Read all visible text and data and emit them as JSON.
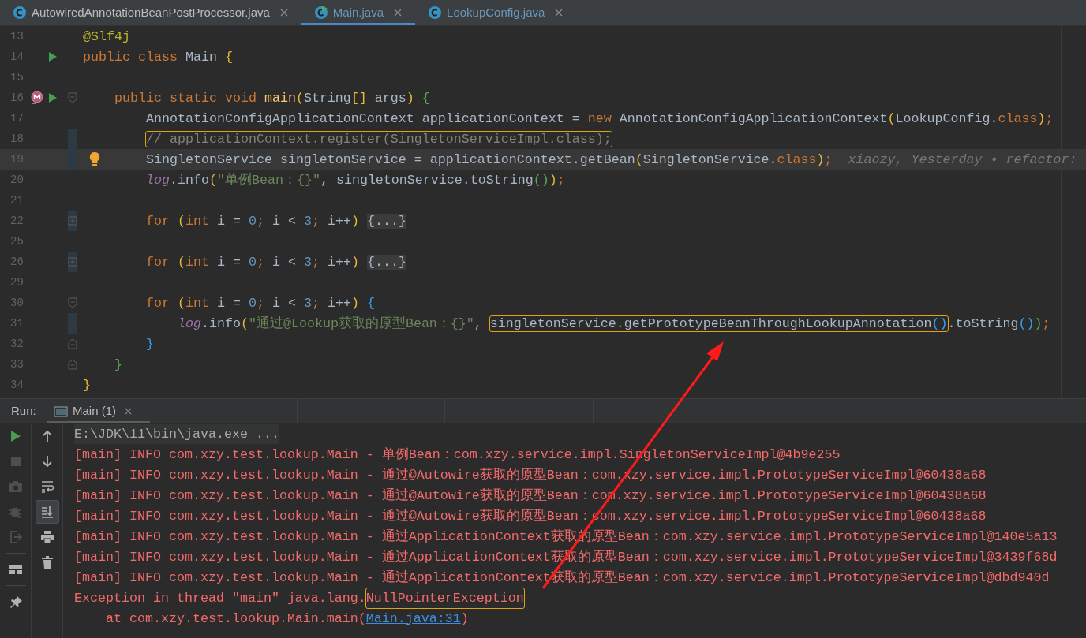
{
  "editor_tabs": [
    {
      "label": "AutowiredAnnotationBeanPostProcessor.java",
      "kind": "class",
      "modified": false,
      "selected": false
    },
    {
      "label": "Main.java",
      "kind": "runnable",
      "modified": true,
      "selected": true
    },
    {
      "label": "LookupConfig.java",
      "kind": "class",
      "modified": true,
      "selected": false
    }
  ],
  "code_lines": [
    {
      "number": "13",
      "changed": false,
      "current": false,
      "segments": [
        {
          "text": "@Slf4j",
          "kind": "annotation"
        }
      ]
    },
    {
      "number": "14",
      "changed": false,
      "current": false,
      "gutter": [
        {
          "kind": "run"
        }
      ],
      "segments": [
        {
          "text": "public class ",
          "kind": "keyword"
        },
        {
          "text": "Main ",
          "kind": "plain"
        },
        {
          "text": "{",
          "kind": "paren1"
        }
      ]
    },
    {
      "number": "15",
      "changed": false,
      "current": false
    },
    {
      "number": "16",
      "changed": false,
      "current": false,
      "gutter": [
        {
          "kind": "method"
        },
        {
          "kind": "run"
        }
      ],
      "fold": {
        "kind": "start"
      },
      "segments": [
        {
          "text": "    public static void ",
          "kind": "keyword"
        },
        {
          "text": "main",
          "kind": "method"
        },
        {
          "text": "(",
          "kind": "paren1"
        },
        {
          "text": "String",
          "kind": "plain"
        },
        {
          "text": "[]",
          "kind": "paren1"
        },
        {
          "text": " args",
          "kind": "plain"
        },
        {
          "text": ")",
          "kind": "paren1"
        },
        {
          "text": " {",
          "kind": "paren2"
        }
      ]
    },
    {
      "number": "17",
      "changed": false,
      "current": false,
      "segments": [
        {
          "text": "        AnnotationConfigApplicationContext applicationContext = ",
          "kind": "plain"
        },
        {
          "text": "new ",
          "kind": "keyword"
        },
        {
          "text": "AnnotationConfigApplicationContext",
          "kind": "plain"
        },
        {
          "text": "(",
          "kind": "paren1"
        },
        {
          "text": "LookupConfig.",
          "kind": "plain"
        },
        {
          "text": "class",
          "kind": "keyword"
        },
        {
          "text": ")",
          "kind": "paren1"
        },
        {
          "text": ";",
          "kind": "keyword"
        }
      ]
    },
    {
      "number": "18",
      "changed": true,
      "current": false,
      "segments": [
        {
          "text": "        // applicationContext.register(SingletonServiceImpl.class);",
          "kind": "comment",
          "boxed": true
        }
      ]
    },
    {
      "number": "19",
      "changed": true,
      "current": true,
      "gutter": [
        {
          "kind": "bulb"
        }
      ],
      "segments": [
        {
          "text": "        SingletonService singletonService = applicationContext.getBean",
          "kind": "plain"
        },
        {
          "text": "(",
          "kind": "paren1"
        },
        {
          "text": "SingletonService.",
          "kind": "plain"
        },
        {
          "text": "class",
          "kind": "keyword"
        },
        {
          "text": ")",
          "kind": "paren1"
        },
        {
          "text": ";",
          "kind": "keyword"
        },
        {
          "text": "  xiaozy, Yesterday • refactor:",
          "kind": "hint"
        }
      ]
    },
    {
      "number": "20",
      "changed": false,
      "current": false,
      "segments": [
        {
          "text": "        log",
          "kind": "field"
        },
        {
          "text": ".info",
          "kind": "plain"
        },
        {
          "text": "(",
          "kind": "paren1"
        },
        {
          "text": "\"单例Bean：{}\"",
          "kind": "string"
        },
        {
          "text": ", singletonService.toString",
          "kind": "plain"
        },
        {
          "text": "()",
          "kind": "paren2"
        },
        {
          "text": ")",
          "kind": "paren1"
        },
        {
          "text": ";",
          "kind": "keyword"
        }
      ]
    },
    {
      "number": "21",
      "changed": false,
      "current": false
    },
    {
      "number": "22",
      "changed": true,
      "current": false,
      "fold": {
        "kind": "collapsed"
      },
      "segments": [
        {
          "text": "        for ",
          "kind": "keyword"
        },
        {
          "text": "(",
          "kind": "paren1"
        },
        {
          "text": "int ",
          "kind": "keyword"
        },
        {
          "text": "i = ",
          "kind": "plain"
        },
        {
          "text": "0",
          "kind": "number"
        },
        {
          "text": "; ",
          "kind": "keyword"
        },
        {
          "text": "i < ",
          "kind": "plain"
        },
        {
          "text": "3",
          "kind": "number"
        },
        {
          "text": "; ",
          "kind": "keyword"
        },
        {
          "text": "i++",
          "kind": "plain"
        },
        {
          "text": ") ",
          "kind": "paren1"
        },
        {
          "text": "{...}",
          "kind": "folded"
        }
      ]
    },
    {
      "number": "25",
      "changed": false,
      "current": false
    },
    {
      "number": "26",
      "changed": true,
      "current": false,
      "fold": {
        "kind": "collapsed"
      },
      "segments": [
        {
          "text": "        for ",
          "kind": "keyword"
        },
        {
          "text": "(",
          "kind": "paren1"
        },
        {
          "text": "int ",
          "kind": "keyword"
        },
        {
          "text": "i = ",
          "kind": "plain"
        },
        {
          "text": "0",
          "kind": "number"
        },
        {
          "text": "; ",
          "kind": "keyword"
        },
        {
          "text": "i < ",
          "kind": "plain"
        },
        {
          "text": "3",
          "kind": "number"
        },
        {
          "text": "; ",
          "kind": "keyword"
        },
        {
          "text": "i++",
          "kind": "plain"
        },
        {
          "text": ") ",
          "kind": "paren1"
        },
        {
          "text": "{...}",
          "kind": "folded"
        }
      ]
    },
    {
      "number": "29",
      "changed": false,
      "current": false
    },
    {
      "number": "30",
      "changed": false,
      "current": false,
      "fold": {
        "kind": "start"
      },
      "segments": [
        {
          "text": "        for ",
          "kind": "keyword"
        },
        {
          "text": "(",
          "kind": "paren1"
        },
        {
          "text": "int ",
          "kind": "keyword"
        },
        {
          "text": "i = ",
          "kind": "plain"
        },
        {
          "text": "0",
          "kind": "number"
        },
        {
          "text": "; ",
          "kind": "keyword"
        },
        {
          "text": "i < ",
          "kind": "plain"
        },
        {
          "text": "3",
          "kind": "number"
        },
        {
          "text": "; ",
          "kind": "keyword"
        },
        {
          "text": "i++",
          "kind": "plain"
        },
        {
          "text": ")",
          "kind": "paren1"
        },
        {
          "text": " {",
          "kind": "paren3"
        }
      ]
    },
    {
      "number": "31",
      "changed": true,
      "current": false,
      "segments": [
        {
          "text": "            log",
          "kind": "field"
        },
        {
          "text": ".info",
          "kind": "plain"
        },
        {
          "text": "(",
          "kind": "paren1"
        },
        {
          "text": "\"通过@Lookup获取的原型Bean：{}\"",
          "kind": "string"
        },
        {
          "text": ", ",
          "kind": "plain"
        },
        {
          "text": "singletonService.getPrototypeBeanThroughLookupAnnotation",
          "kind": "plain",
          "boxed": true
        },
        {
          "text": "()",
          "kind": "paren3",
          "boxed": true
        },
        {
          "text": ".toString",
          "kind": "plain"
        },
        {
          "text": "()",
          "kind": "paren3"
        },
        {
          "text": ")",
          "kind": "paren2"
        },
        {
          "text": ";",
          "kind": "keyword"
        }
      ]
    },
    {
      "number": "32",
      "changed": false,
      "current": false,
      "fold": {
        "kind": "end"
      },
      "segments": [
        {
          "text": "        }",
          "kind": "paren3"
        }
      ]
    },
    {
      "number": "33",
      "changed": false,
      "current": false,
      "fold": {
        "kind": "end"
      },
      "segments": [
        {
          "text": "    }",
          "kind": "paren2"
        }
      ]
    },
    {
      "number": "34",
      "changed": false,
      "current": false,
      "segments": [
        {
          "text": "}",
          "kind": "paren1"
        }
      ]
    }
  ],
  "run_panel": {
    "label": "Run:",
    "tabs": [
      {
        "label": "Main (1)",
        "selected": true
      }
    ],
    "toolbar_left": [
      {
        "kind": "run",
        "disabled": false
      },
      {
        "kind": "stop",
        "disabled": true
      },
      {
        "kind": "camera",
        "disabled": true
      },
      {
        "kind": "debug",
        "disabled": true
      },
      {
        "kind": "exit",
        "disabled": true
      },
      {
        "kind": "separator"
      },
      {
        "kind": "layout",
        "disabled": false
      },
      {
        "kind": "separator"
      },
      {
        "kind": "pin",
        "disabled": false
      }
    ],
    "toolbar_right": [
      {
        "kind": "up",
        "selected": false
      },
      {
        "kind": "down",
        "selected": false
      },
      {
        "kind": "wrap",
        "selected": false
      },
      {
        "kind": "scroll-end",
        "selected": true
      },
      {
        "kind": "print",
        "selected": false
      },
      {
        "kind": "trash",
        "selected": false
      }
    ],
    "console_lines": [
      {
        "segments": [
          {
            "text": "E:\\JDK\\11\\bin\\java.exe ...",
            "kind": "command"
          }
        ]
      },
      {
        "segments": [
          {
            "text": "[main] INFO com.xzy.test.lookup.Main - 单例Bean：com.xzy.service.impl.SingletonServiceImpl@4b9e255",
            "kind": "error"
          }
        ]
      },
      {
        "segments": [
          {
            "text": "[main] INFO com.xzy.test.lookup.Main - 通过@Autowire获取的原型Bean：com.xzy.service.impl.PrototypeServiceImpl@60438a68",
            "kind": "error"
          }
        ]
      },
      {
        "segments": [
          {
            "text": "[main] INFO com.xzy.test.lookup.Main - 通过@Autowire获取的原型Bean：com.xzy.service.impl.PrototypeServiceImpl@60438a68",
            "kind": "error"
          }
        ]
      },
      {
        "segments": [
          {
            "text": "[main] INFO com.xzy.test.lookup.Main - 通过@Autowire获取的原型Bean：com.xzy.service.impl.PrototypeServiceImpl@60438a68",
            "kind": "error"
          }
        ]
      },
      {
        "segments": [
          {
            "text": "[main] INFO com.xzy.test.lookup.Main - 通过ApplicationContext获取的原型Bean：com.xzy.service.impl.PrototypeServiceImpl@140e5a13",
            "kind": "error"
          }
        ]
      },
      {
        "segments": [
          {
            "text": "[main] INFO com.xzy.test.lookup.Main - 通过ApplicationContext获取的原型Bean：com.xzy.service.impl.PrototypeServiceImpl@3439f68d",
            "kind": "error"
          }
        ]
      },
      {
        "segments": [
          {
            "text": "[main] INFO com.xzy.test.lookup.Main - 通过ApplicationContext获取的原型Bean：com.xzy.service.impl.PrototypeServiceImpl@dbd940d",
            "kind": "error"
          }
        ]
      },
      {
        "segments": [
          {
            "text": "Exception in thread \"main\" java.lang.",
            "kind": "error"
          },
          {
            "text": "NullPointerException",
            "kind": "error",
            "boxed": true
          }
        ]
      },
      {
        "segments": [
          {
            "text": "    at com.xzy.test.lookup.Main.main(",
            "kind": "error"
          },
          {
            "text": "Main.java:31",
            "kind": "link"
          },
          {
            "text": ")",
            "kind": "error"
          }
        ]
      }
    ]
  }
}
